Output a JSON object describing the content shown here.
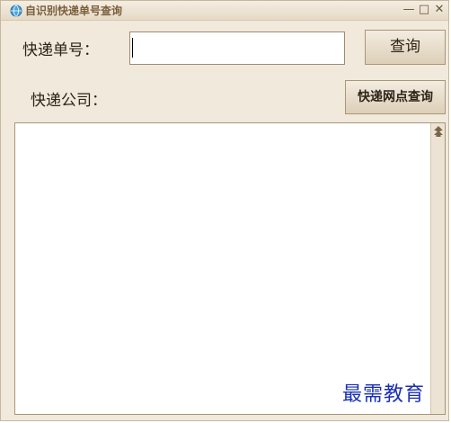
{
  "window": {
    "title": "自识别快递单号查询",
    "controls": {
      "minimize": "—",
      "maximize": "□",
      "close": "✕"
    }
  },
  "form": {
    "number_label": "快递单号：",
    "number_value": "",
    "company_label": "快递公司：",
    "query_button": "查询",
    "outlet_button": "快递网点查询"
  },
  "result": {
    "content": ""
  },
  "watermark": "最需教育",
  "icons": {
    "app": "globe-icon",
    "scroll_up": "double-up-arrow-icon"
  },
  "colors": {
    "window_bg": "#f1e9dc",
    "title_text": "#7a5f3d",
    "watermark": "#1a2fb4"
  }
}
